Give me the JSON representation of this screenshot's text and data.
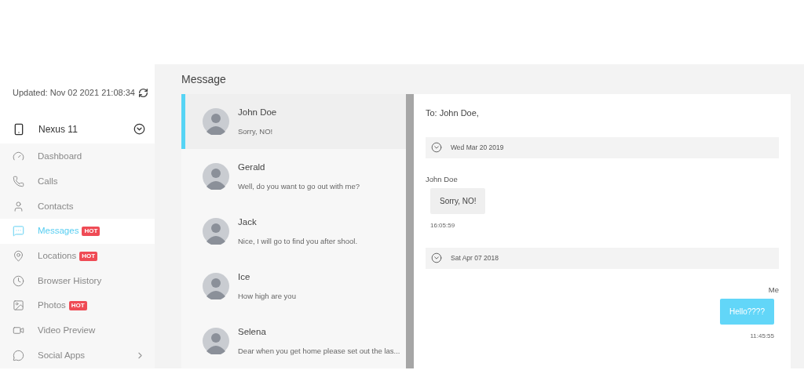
{
  "sidebar": {
    "updated": "Updated: Nov 02 2021 21:08:34",
    "device": "Nexus 11",
    "items": [
      {
        "label": "Dashboard",
        "kind": "dashboard",
        "selected": false,
        "submenu": false
      },
      {
        "label": "Calls",
        "kind": "calls",
        "selected": false,
        "submenu": false
      },
      {
        "label": "Contacts",
        "kind": "contacts",
        "selected": false,
        "submenu": false
      },
      {
        "label": "Messages",
        "kind": "messages",
        "selected": true,
        "badge": "HOT",
        "submenu": false
      },
      {
        "label": "Locations",
        "kind": "locations",
        "selected": false,
        "badge": "HOT",
        "submenu": false
      },
      {
        "label": "Browser History",
        "kind": "history",
        "selected": false,
        "submenu": false
      },
      {
        "label": "Photos",
        "kind": "photos",
        "selected": false,
        "badge": "HOT",
        "submenu": false
      },
      {
        "label": "Video Preview",
        "kind": "video",
        "selected": false,
        "submenu": false
      },
      {
        "label": "Social Apps",
        "kind": "social",
        "selected": false,
        "submenu": true
      }
    ]
  },
  "title": "Message",
  "conversations": [
    {
      "name": "John Doe",
      "preview": "Sorry, NO!",
      "selected": true
    },
    {
      "name": "Gerald",
      "preview": "Well, do you want to go out with me?",
      "selected": false
    },
    {
      "name": "Jack",
      "preview": "Nice, I will go to find you after shool.",
      "selected": false
    },
    {
      "name": "Ice",
      "preview": "How high are you",
      "selected": false
    },
    {
      "name": "Selena",
      "preview": "Dear when you get home please set out the las...",
      "selected": false
    }
  ],
  "chat": {
    "to": "To: John Doe,",
    "groups": [
      {
        "date": "Wed Mar 20 2019",
        "messages": [
          {
            "sender": "John Doe",
            "text": "Sorry, NO!",
            "time": "16:05:59",
            "outgoing": false
          }
        ]
      },
      {
        "date": "Sat Apr 07 2018",
        "messages": [
          {
            "sender": "Me",
            "text": "Hello????",
            "time": "11:45:55",
            "outgoing": true
          }
        ]
      }
    ]
  }
}
